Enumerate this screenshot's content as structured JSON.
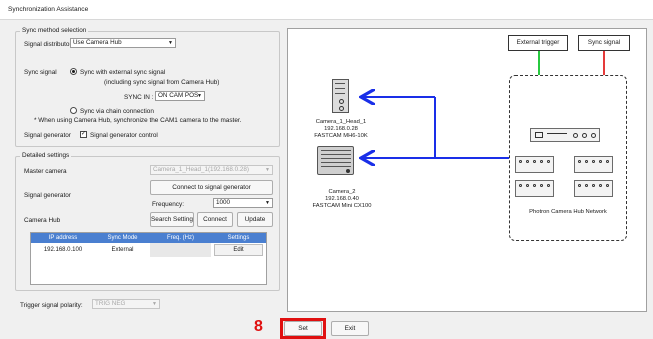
{
  "window": {
    "title": "Synchronization Assistance"
  },
  "sync_method": {
    "group_title": "Sync method selection",
    "signal_distributor_label": "Signal distributor",
    "signal_distributor_value": "Use Camera Hub",
    "sync_signal_label": "Sync signal",
    "option_external": "Sync with external sync signal",
    "option_external_sub": "(including sync signal from Camera Hub)",
    "sync_in_label": "SYNC IN :",
    "sync_in_value": "ON CAM POS",
    "option_chain": "Sync via chain connection",
    "chain_note": "* When using Camera Hub, synchronize the CAM1 camera to the master.",
    "signal_generator_label": "Signal generator",
    "signal_generator_control": "Signal generator control"
  },
  "detailed": {
    "group_title": "Detailed settings",
    "master_camera_label": "Master camera",
    "master_camera_value": "Camera_1_Head_1(192.168.0.28)",
    "signal_generator_label": "Signal generator",
    "connect_button": "Connect to signal generator",
    "frequency_label": "Frequency:",
    "frequency_value": "1000",
    "camera_hub_label": "Camera Hub",
    "search_button": "Search Setting",
    "connect_hub_button": "Connect",
    "update_button": "Update",
    "table_headers": [
      "IP address",
      "Sync Mode",
      "Freq. (Hz)",
      "Settings"
    ],
    "table_rows": [
      {
        "ip": "192.168.0.100",
        "mode": "External",
        "freq": "",
        "settings": "Edit"
      }
    ]
  },
  "trigger": {
    "label": "Trigger signal polarity:",
    "value": "TRIG NEG"
  },
  "diagram": {
    "external_trigger": "External trigger",
    "sync_signal": "Sync signal",
    "camera1": [
      "Camera_1_Head_1",
      "192.168.0.28",
      "FASTCAM MH6-10K"
    ],
    "camera2": [
      "Camera_2",
      "192.168.0.40",
      "FASTCAM Mini CX100"
    ],
    "hub_network": "Photron Camera Hub Network",
    "colors": {
      "arrow": "#1a2fe8",
      "external_trigger_line": "#27c93f",
      "sync_signal_line": "#e53a3a"
    }
  },
  "footer": {
    "step_number": "8",
    "set_button": "Set",
    "exit_button": "Exit",
    "highlight_color": "#e01010"
  }
}
